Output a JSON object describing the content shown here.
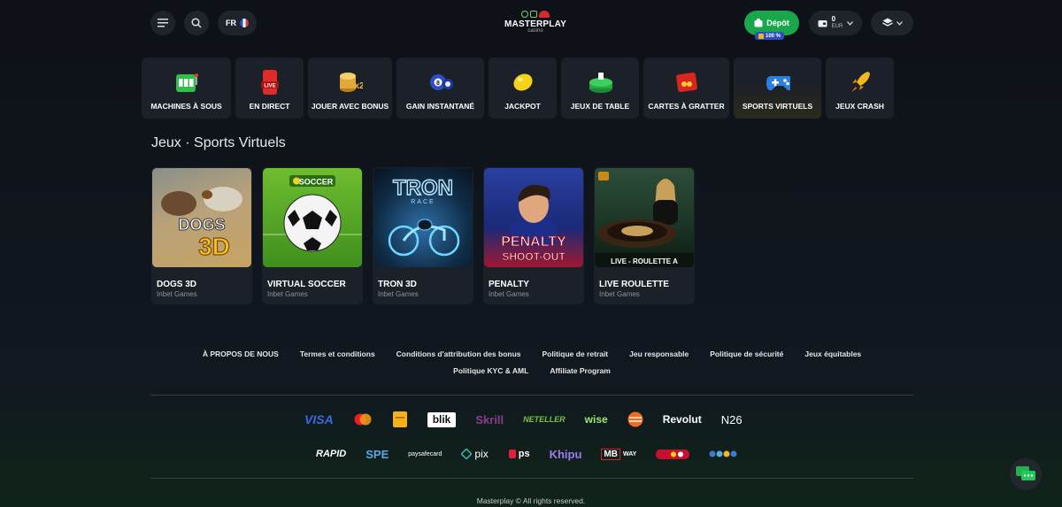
{
  "header": {
    "lang": "FR",
    "logo_text": "MASTERPLAY",
    "logo_sub": "casino",
    "deposit_label": "Dépôt",
    "deposit_badge": "100 %",
    "wallet_amount": "0",
    "wallet_currency": "EUR"
  },
  "categories": [
    {
      "label": "MACHINES À SOUS",
      "icon": "slot-machine-icon"
    },
    {
      "label": "EN DIRECT",
      "icon": "live-phone-icon",
      "badge": "LIVE"
    },
    {
      "label": "JOUER AVEC BONUS",
      "icon": "coins-x2-icon",
      "badge": "x2"
    },
    {
      "label": "GAIN INSTANTANÉ",
      "icon": "lottery-balls-icon",
      "badge": "8"
    },
    {
      "label": "JACKPOT",
      "icon": "lemon-icon"
    },
    {
      "label": "JEUX DE TABLE",
      "icon": "card-table-icon"
    },
    {
      "label": "CARTES À GRATTER",
      "icon": "scratch-card-icon"
    },
    {
      "label": "SPORTS VIRTUELS",
      "icon": "gamepad-icon",
      "active": true
    },
    {
      "label": "JEUX CRASH",
      "icon": "rocket-icon"
    }
  ],
  "section_title": "Jeux · Sports Virtuels",
  "games": [
    {
      "name": "DOGS 3D",
      "provider": "Inbet Games",
      "art": "DOGS",
      "art2": "3D"
    },
    {
      "name": "VIRTUAL SOCCER",
      "provider": "Inbet Games",
      "art": "SOCCER"
    },
    {
      "name": "TRON 3D",
      "provider": "Inbet Games",
      "art": "TRON",
      "art2": "RACE"
    },
    {
      "name": "PENALTY",
      "provider": "Inbet Games",
      "art": "PENALTY",
      "art2": "SHOOT-OUT"
    },
    {
      "name": "LIVE ROULETTE",
      "provider": "Inbet Games",
      "art": "LIVE - ROULETTE A"
    }
  ],
  "footer_links": [
    "À PROPOS DE NOUS",
    "Termes et conditions",
    "Conditions d'attribution des bonus",
    "Politique de retrait",
    "Jeu responsable",
    "Politique de sécurité",
    "Jeux équitables",
    "Politique KYC & AML",
    "Affiliate Program"
  ],
  "payments_row1": [
    "VISA",
    "mastercard",
    "interac",
    "blik",
    "Skrill",
    "NETELLER",
    "wise",
    "circle",
    "Revolut",
    "N26"
  ],
  "payments_row2": [
    "RAPID",
    "SPE",
    "paysafecard",
    "pix",
    "ps",
    "Khipu",
    "MB WAY",
    "bank",
    "multibanco"
  ],
  "payment_text": {
    "visa": "VISA",
    "blik": "blik",
    "skrill": "Skrill",
    "neteller": "NETELLER",
    "wise": "wise",
    "revolut": "Revolut",
    "n26": "N26",
    "rapid": "RAPID",
    "spe": "SPE",
    "paysafecard": "paysafecard",
    "pix": "pix",
    "ps": "ps",
    "khipu": "Khipu",
    "mbway_mb": "MB",
    "mbway_way": "WAY"
  },
  "copyright": "Masterplay © All rights reserved.",
  "colors": {
    "bg": "#0e1117",
    "card": "#1b2029",
    "accent_green": "#1aa64a",
    "badge_blue": "#2a4fbf"
  }
}
